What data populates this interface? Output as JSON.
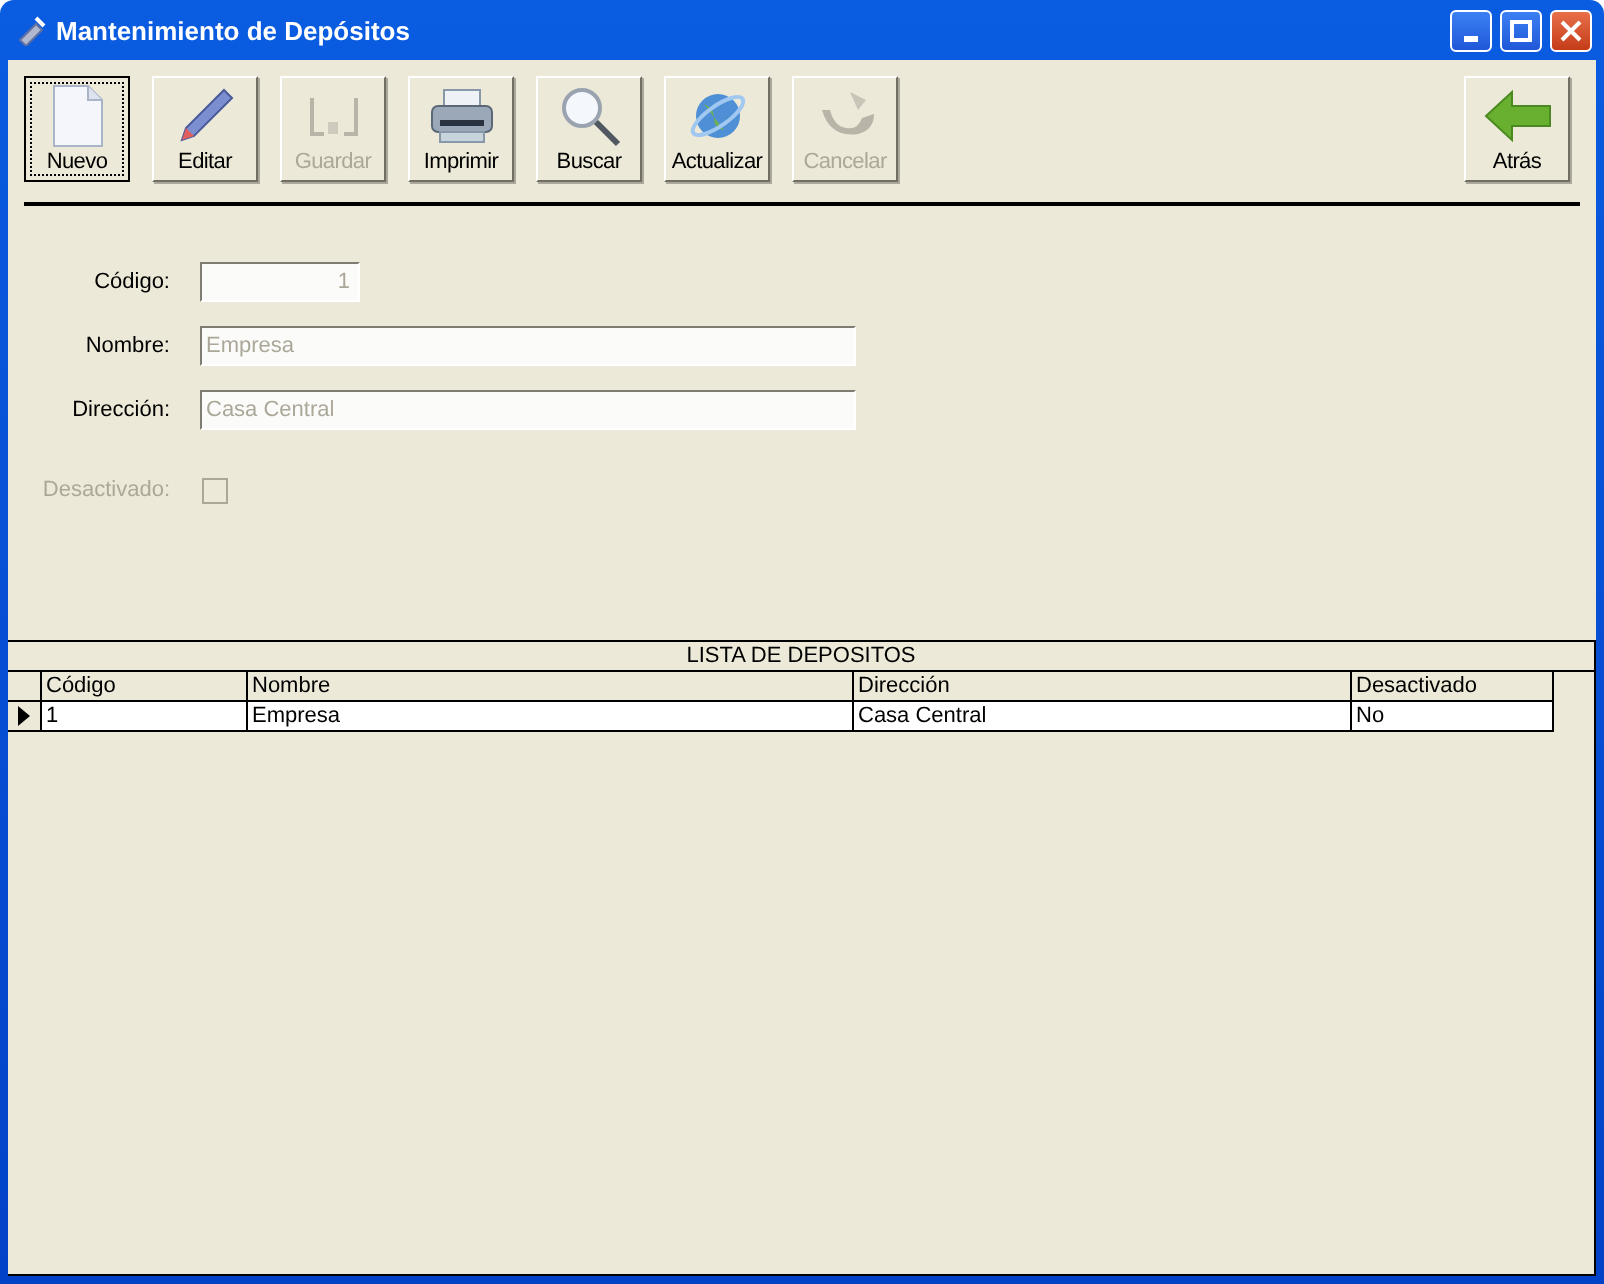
{
  "window": {
    "title": "Mantenimiento de Depósitos"
  },
  "toolbar": [
    {
      "label": "Nuevo",
      "kind": "new",
      "disabled": false,
      "focused": true
    },
    {
      "label": "Editar",
      "kind": "edit",
      "disabled": false,
      "focused": false
    },
    {
      "label": "Guardar",
      "kind": "save",
      "disabled": true,
      "focused": false
    },
    {
      "label": "Imprimir",
      "kind": "print",
      "disabled": false,
      "focused": false
    },
    {
      "label": "Buscar",
      "kind": "search",
      "disabled": false,
      "focused": false
    },
    {
      "label": "Actualizar",
      "kind": "refresh",
      "disabled": false,
      "focused": false
    },
    {
      "label": "Cancelar",
      "kind": "cancel",
      "disabled": true,
      "focused": false
    }
  ],
  "back_button": {
    "label": "Atrás"
  },
  "form": [
    {
      "kind": "number",
      "label": "Código:",
      "value": "1",
      "disabled": false
    },
    {
      "kind": "text",
      "label": "Nombre:",
      "value": "Empresa",
      "disabled": false
    },
    {
      "kind": "text",
      "label": "Dirección:",
      "value": "Casa Central",
      "disabled": false
    },
    {
      "kind": "checkbox",
      "label": "Desactivado:",
      "checked": false,
      "disabled": true
    }
  ],
  "grid": {
    "title": "LISTA DE DEPOSITOS",
    "columns": [
      "Código",
      "Nombre",
      "Dirección",
      "Desactivado"
    ],
    "rows": [
      {
        "cells": [
          "1",
          "Empresa",
          "Casa Central",
          "No"
        ],
        "selected": true
      }
    ]
  }
}
